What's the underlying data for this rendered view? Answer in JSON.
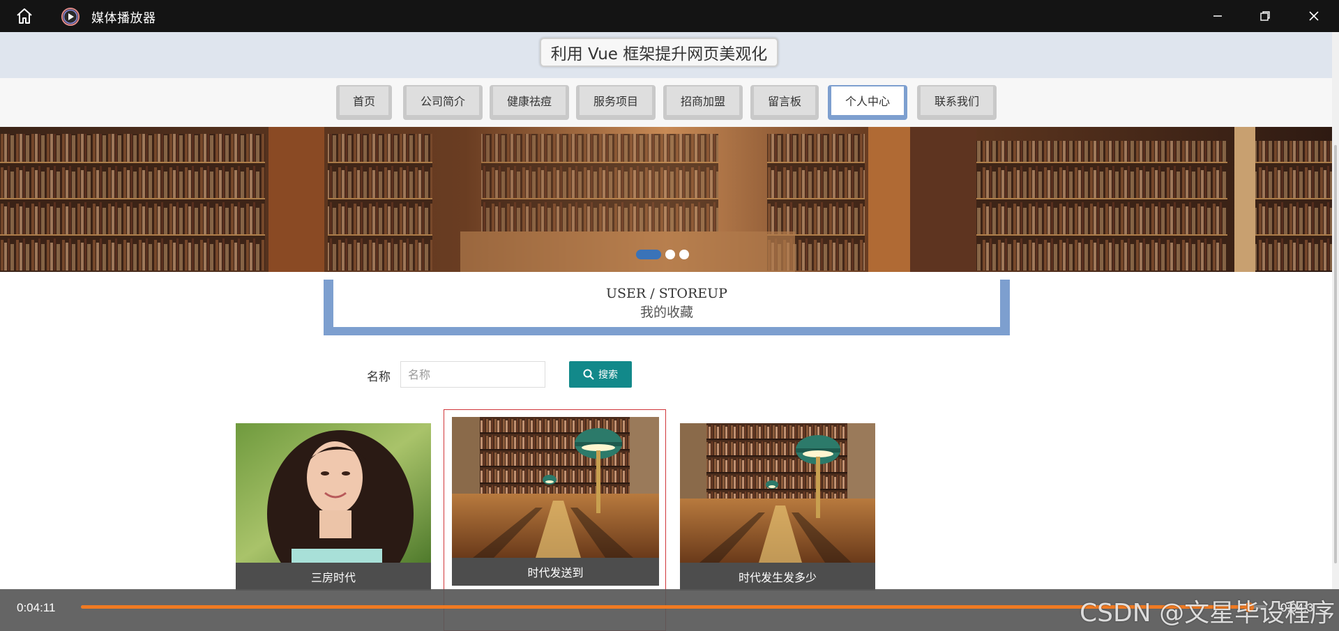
{
  "window": {
    "title": "媒体播放器",
    "home_icon": "home-icon",
    "app_icon": "play-circle-icon",
    "controls": [
      "minimize-icon",
      "restore-icon",
      "close-icon"
    ]
  },
  "site": {
    "title": "利用 Vue 框架提升网页美观化"
  },
  "nav": {
    "items": [
      {
        "label": "首页",
        "active": false
      },
      {
        "label": "公司简介",
        "active": false
      },
      {
        "label": "健康祛痘",
        "active": false
      },
      {
        "label": "服务项目",
        "active": false
      },
      {
        "label": "招商加盟",
        "active": false
      },
      {
        "label": "留言板",
        "active": false
      },
      {
        "label": "个人中心",
        "active": true
      },
      {
        "label": "联系我们",
        "active": false
      }
    ]
  },
  "banner": {
    "slide_count": 3,
    "active_slide": 1
  },
  "section": {
    "title_en": "USER / STOREUP",
    "title_cn": "我的收藏"
  },
  "search": {
    "label": "名称",
    "placeholder": "名称",
    "value": "",
    "button_label": "搜索",
    "button_icon": "search-icon"
  },
  "cards": [
    {
      "caption": "三房时代",
      "image": "portrait-woman"
    },
    {
      "caption": "时代发送到",
      "image": "library-reading-room"
    },
    {
      "caption": "时代发生发多少",
      "image": "library-reading-room"
    }
  ],
  "player": {
    "elapsed": "0:04:11",
    "total": "0:04:3",
    "progress": 0.985
  },
  "watermark": "CSDN @文星毕设程序",
  "colors": {
    "accent_blue": "#7d9fcf",
    "search_button": "#12898a",
    "progress": "#f07a22",
    "caption_bg": "#4d4d4d"
  }
}
